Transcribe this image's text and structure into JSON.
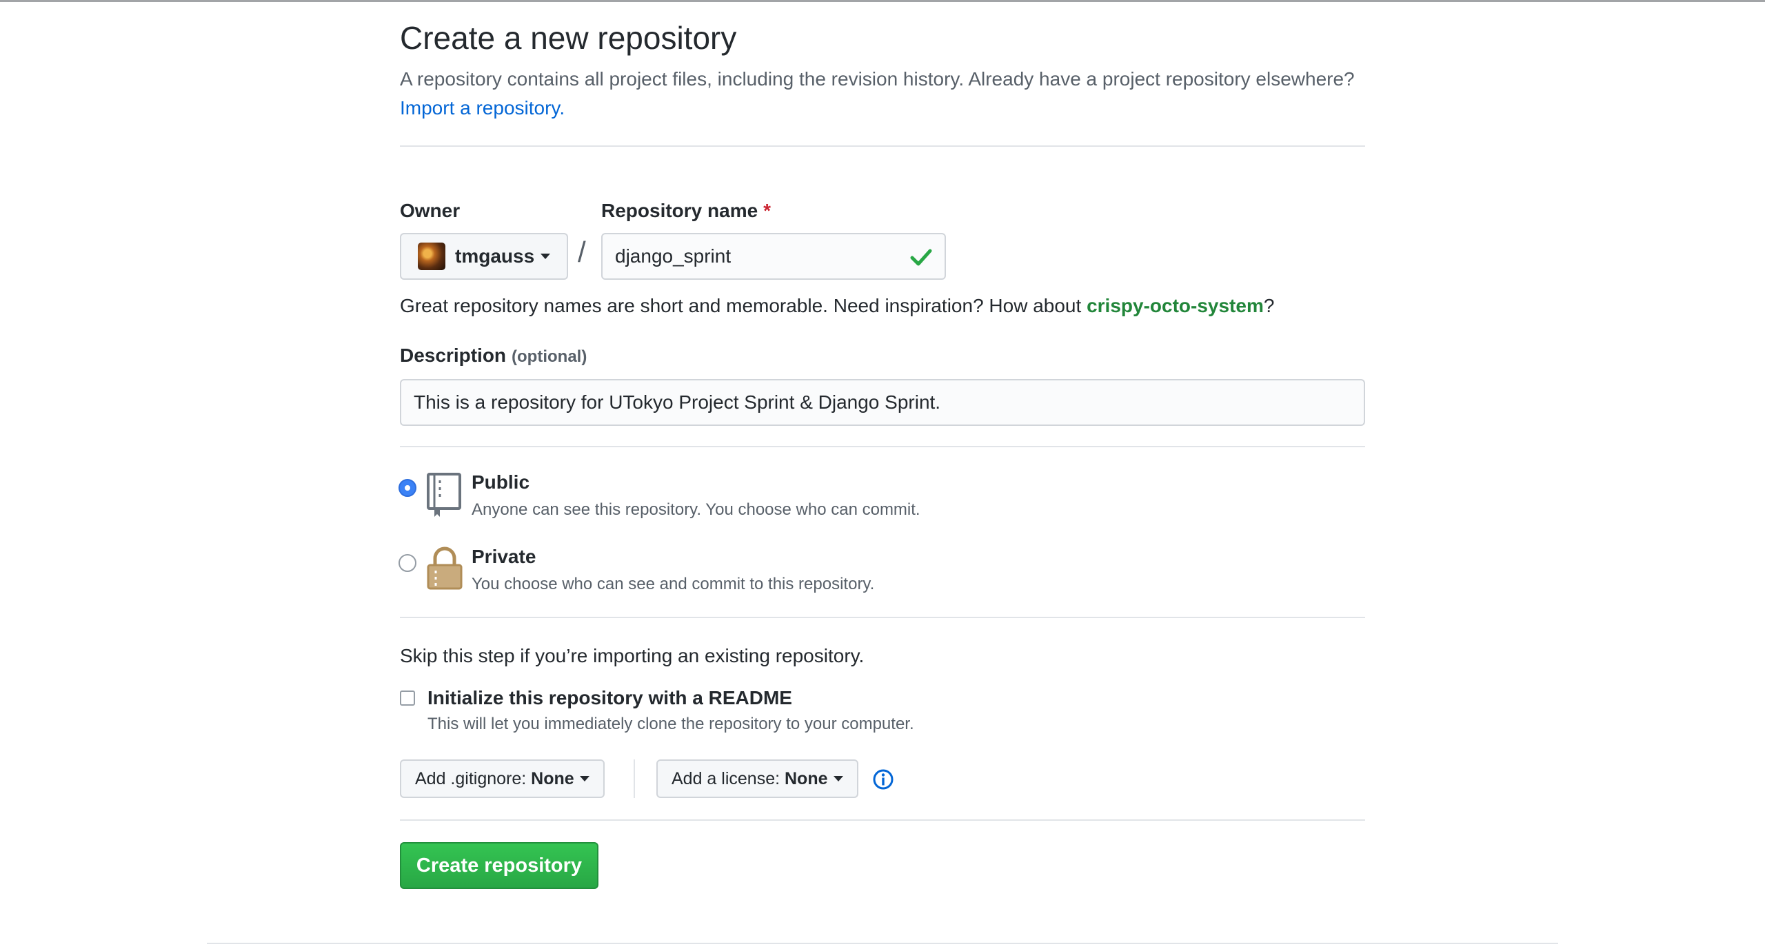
{
  "header": {
    "title": "Create a new repository",
    "subtitle": "A repository contains all project files, including the revision history. Already have a project repository elsewhere?",
    "import_link": "Import a repository."
  },
  "owner": {
    "label": "Owner",
    "value": "tmgauss"
  },
  "repo_name": {
    "label": "Repository name",
    "required_mark": "*",
    "value": "django_sprint",
    "valid_icon": "check-icon"
  },
  "separator": "/",
  "hint": {
    "text": "Great repository names are short and memorable. Need inspiration? How about",
    "suggestion": "crispy-octo-system",
    "end": "?"
  },
  "description": {
    "label": "Description",
    "optional": "(optional)",
    "value": "This is a repository for UTokyo Project Sprint & Django Sprint."
  },
  "visibility": {
    "selected": "public",
    "options": [
      {
        "title": "Public",
        "desc": "Anyone can see this repository. You choose who can commit.",
        "icon": "repo-icon"
      },
      {
        "title": "Private",
        "desc": "You choose who can see and commit to this repository.",
        "icon": "lock-icon"
      }
    ]
  },
  "init": {
    "skip_text": "Skip this step if you’re importing an existing repository.",
    "readme_label": "Initialize this repository with a README",
    "readme_desc": "This will let you immediately clone the repository to your computer.",
    "readme_checked": false
  },
  "gitignore": {
    "label": "Add .gitignore:",
    "value": "None"
  },
  "license": {
    "label": "Add a license:",
    "value": "None",
    "info_icon": "info-icon"
  },
  "create_button": "Create repository",
  "colors": {
    "link": "#0366d6",
    "suggestion": "#22863a",
    "create_button": "#28a745",
    "required": "#cb2431",
    "radio_selected": "#3b82f6",
    "public_icon": "#6a737d",
    "private_icon": "#b08800"
  }
}
